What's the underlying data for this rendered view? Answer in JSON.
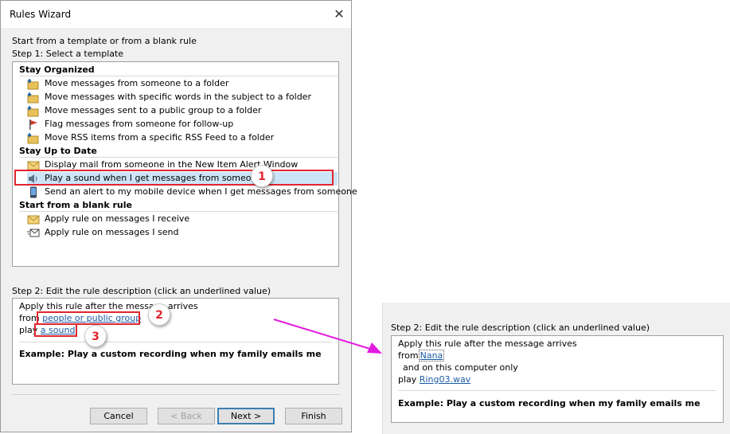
{
  "dialog": {
    "title": "Rules Wizard",
    "close_glyph": "✕",
    "intro": "Start from a template or from a blank rule",
    "step1_label": "Step 1: Select a template",
    "sections": [
      {
        "title": "Stay Organized",
        "items": [
          {
            "label": "Move messages from someone to a folder",
            "icon": "move-folder-icon"
          },
          {
            "label": "Move messages with specific words in the subject to a folder",
            "icon": "move-folder-icon"
          },
          {
            "label": "Move messages sent to a public group to a folder",
            "icon": "move-folder-icon"
          },
          {
            "label": "Flag messages from someone for follow-up",
            "icon": "flag-icon"
          },
          {
            "label": "Move RSS items from a specific RSS Feed to a folder",
            "icon": "move-folder-icon"
          }
        ]
      },
      {
        "title": "Stay Up to Date",
        "items": [
          {
            "label": "Display mail from someone in the New Item Alert Window",
            "icon": "mail-alert-icon"
          },
          {
            "label": "Play a sound when I get messages from someone",
            "icon": "speaker-icon",
            "selected": true
          },
          {
            "label": "Send an alert to my mobile device when I get messages from someone",
            "icon": "mobile-icon"
          }
        ]
      },
      {
        "title": "Start from a blank rule",
        "items": [
          {
            "label": "Apply rule on messages I receive",
            "icon": "envelope-icon"
          },
          {
            "label": "Apply rule on messages I send",
            "icon": "send-envelope-icon"
          }
        ]
      }
    ],
    "step2_label": "Step 2: Edit the rule description (click an underlined value)",
    "description": {
      "line1": "Apply this rule after the message arrives",
      "from_prefix": "from",
      "from_link": "people or public group",
      "play_prefix": "play",
      "play_link": "a sound",
      "example": "Example: Play a custom recording when my family emails me"
    },
    "buttons": {
      "cancel": "Cancel",
      "back": "< Back",
      "next": "Next >",
      "finish": "Finish"
    }
  },
  "callouts": [
    "1",
    "2",
    "3"
  ],
  "result_panel": {
    "step2_label": "Step 2: Edit the rule description (click an underlined value)",
    "line1": "Apply this rule after the message arrives",
    "from_prefix": "from",
    "from_link": "Nana",
    "line3": "and on this computer only",
    "play_prefix": "play",
    "play_link": "Ring03.wav",
    "example": "Example: Play a custom recording when my family emails me"
  },
  "colors": {
    "highlight_red": "#e0262f",
    "arrow_magenta": "#e21de0",
    "selection_blue": "#cce4f7",
    "link_blue": "#1a5ba6"
  }
}
